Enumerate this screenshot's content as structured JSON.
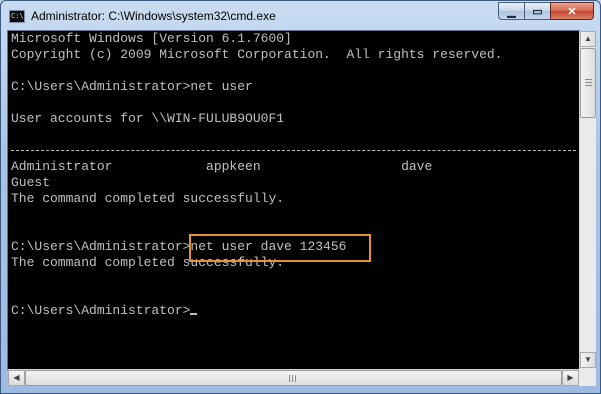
{
  "window": {
    "title": "Administrator: C:\\Windows\\system32\\cmd.exe",
    "icon_text": "C:\\",
    "buttons": {
      "minimize": "▁",
      "maximize": "▭",
      "close": "✕"
    }
  },
  "console": {
    "lines": [
      "Microsoft Windows [Version 6.1.7600]",
      "Copyright (c) 2009 Microsoft Corporation.  All rights reserved.",
      "",
      "C:\\Users\\Administrator>net user",
      "",
      "User accounts for \\\\WIN-FULUB9OU0F1",
      "",
      "-------------------------------------------------------------------------------",
      "Administrator            appkeen                  dave",
      "Guest",
      "The command completed successfully.",
      "",
      "",
      "C:\\Users\\Administrator>net user dave 123456",
      "The command completed successfully.",
      "",
      "",
      "C:\\Users\\Administrator>"
    ],
    "highlighted_command": "net user dave 123456"
  },
  "scrollbars": {
    "up_arrow": "▲",
    "down_arrow": "▼",
    "left_arrow": "◀",
    "right_arrow": "▶"
  },
  "colors": {
    "console_bg": "#000000",
    "console_text": "#c0c0c0",
    "highlight_border": "#e8922e"
  }
}
